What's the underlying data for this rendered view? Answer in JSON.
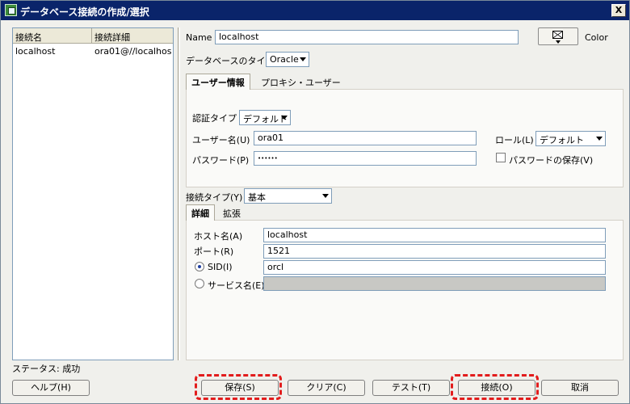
{
  "window": {
    "title": "データベース接続の作成/選択",
    "close_label": "X"
  },
  "connections": {
    "headers": [
      "接続名",
      "接続詳細"
    ],
    "rows": [
      {
        "name": "localhost",
        "details": "ora01@//localhos..."
      }
    ]
  },
  "name": {
    "label": "Name",
    "value": "localhost"
  },
  "color": {
    "label": "Color"
  },
  "db_type": {
    "label": "データベースのタイプ",
    "value": "Oracle"
  },
  "tabs": {
    "user_info": "ユーザー情報",
    "proxy_user": "プロキシ・ユーザー"
  },
  "auth_type": {
    "label": "認証タイプ",
    "value": "デフォルト"
  },
  "username": {
    "label": "ユーザー名(U)",
    "value": "ora01"
  },
  "role": {
    "label": "ロール(L)",
    "value": "デフォルト"
  },
  "password": {
    "label": "パスワード(P)",
    "value": "••••••"
  },
  "save_password": {
    "label": "パスワードの保存(V)",
    "checked": false
  },
  "conn_type": {
    "label": "接続タイプ(Y)",
    "value": "基本"
  },
  "detail_tabs": {
    "details": "詳細",
    "advanced": "拡張"
  },
  "host": {
    "label": "ホスト名(A)",
    "value": "localhost"
  },
  "port": {
    "label": "ポート(R)",
    "value": "1521"
  },
  "sid": {
    "label": "SID(I)",
    "value": "orcl",
    "selected": true
  },
  "service_name": {
    "label": "サービス名(E)",
    "value": "",
    "selected": false
  },
  "status": {
    "text": "ステータス: 成功"
  },
  "buttons": {
    "help": "ヘルプ(H)",
    "save": "保存(S)",
    "clear": "クリア(C)",
    "test": "テスト(T)",
    "connect": "接続(O)",
    "cancel": "取消"
  },
  "colors": {
    "titlebar": "#0a246a",
    "highlight": "#e21c1c"
  }
}
